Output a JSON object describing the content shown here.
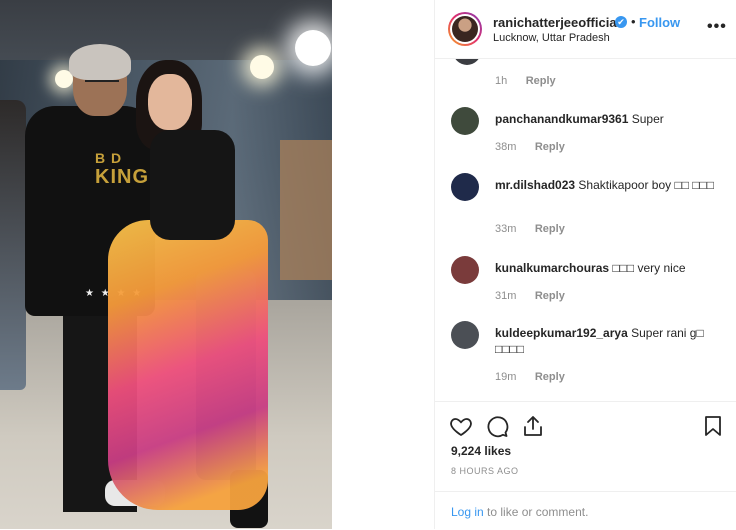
{
  "post": {
    "username": "ranichatterjeeofficial",
    "verified_mark": "✔",
    "separator": "•",
    "follow_label": "Follow",
    "location": "Lucknow, Uttar Pradesh",
    "more_icon": "more-horizontal-icon",
    "more_glyph": "•••",
    "photo_text": "KING",
    "photo_text_top": "B D"
  },
  "comments": {
    "partial": {
      "time": "1h",
      "reply": "Reply"
    },
    "items": [
      {
        "user": "panchanandkumar9361",
        "text": "Super",
        "time": "38m",
        "reply": "Reply",
        "avatar_color": "#3f4a3c"
      },
      {
        "user": "mr.dilshad023",
        "text": "Shaktikapoor boy □□ □□□",
        "time": "33m",
        "reply": "Reply",
        "avatar_color": "#1f2a4a"
      },
      {
        "user": "kunalkumarchouras",
        "text": "□□□ very nice",
        "time": "31m",
        "reply": "Reply",
        "avatar_color": "#7a3b3b"
      },
      {
        "user": "kuldeepkumar192_arya",
        "text": "Super rani g□ □□□□",
        "time": "19m",
        "reply": "Reply",
        "avatar_color": "#4b4f55"
      }
    ]
  },
  "actions": {
    "like_icon": "heart-icon",
    "comment_icon": "comment-icon",
    "share_icon": "share-icon",
    "save_icon": "bookmark-icon",
    "likes": "9,224 likes",
    "time_ago": "8 HOURS AGO"
  },
  "login": {
    "link": "Log in",
    "rest": " to like or comment."
  },
  "colors": {
    "accent": "#3897f0",
    "muted": "#8e8e8e",
    "text": "#262626",
    "border": "#efefef"
  }
}
